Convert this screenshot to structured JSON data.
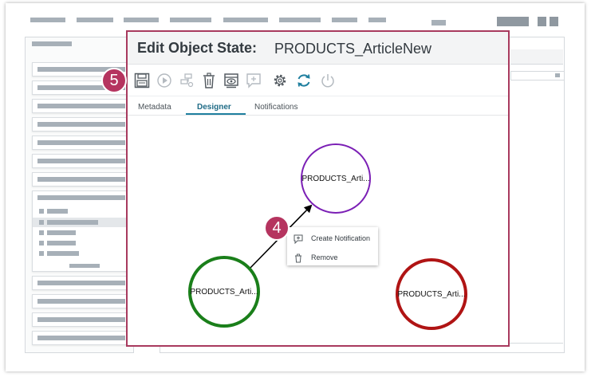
{
  "dialog": {
    "title": "Edit Object State:",
    "object_name": "PRODUCTS_ArticleNew"
  },
  "toolbar": {
    "icons": [
      "save-icon",
      "play-icon",
      "add-transition-icon",
      "delete-icon",
      "view-icon",
      "add-comment-icon",
      "settings-icon",
      "refresh-icon",
      "power-icon"
    ]
  },
  "tabs": [
    {
      "label": "Metadata",
      "active": false
    },
    {
      "label": "Designer",
      "active": true
    },
    {
      "label": "Notifications",
      "active": false
    }
  ],
  "designer": {
    "nodes": [
      {
        "label": "PRODUCTS_Arti...",
        "color": "#7b1fb5"
      },
      {
        "label": "PRODUCTS_Arti...",
        "color": "#1a7f1a"
      },
      {
        "label": "PRODUCTS_Arti...",
        "color": "#b01414"
      }
    ]
  },
  "context_menu": {
    "items": [
      {
        "label": "Create Notification",
        "icon": "add-notification-icon"
      },
      {
        "label": "Remove",
        "icon": "trash-icon"
      }
    ]
  },
  "callouts": {
    "toolbar_step": "5",
    "context_step": "4"
  },
  "colors": {
    "accent": "#b5345f",
    "tab_active": "#1f7f9f"
  }
}
